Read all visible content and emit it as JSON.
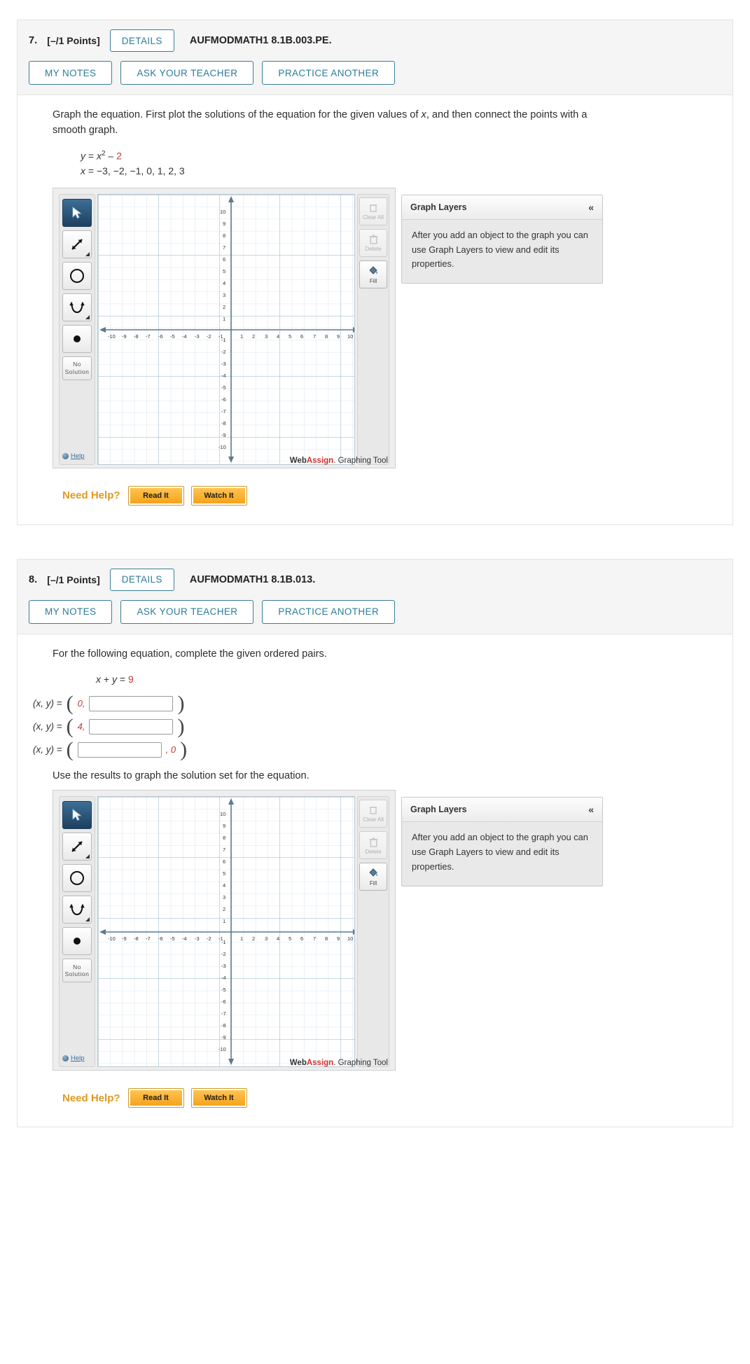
{
  "questions": [
    {
      "number": "7.",
      "points": "[–/1 Points]",
      "details_label": "DETAILS",
      "code": "AUFMODMATH1 8.1B.003.PE.",
      "buttons": [
        "MY NOTES",
        "ASK YOUR TEACHER",
        "PRACTICE ANOTHER"
      ],
      "prompt": "Graph the equation. First plot the solutions of the equation for the given values of x, and then connect the points with a smooth graph.",
      "equation_y": "y = x",
      "equation_y_exp": "2",
      "equation_y_tail": " – ",
      "equation_y_const": "2",
      "equation_x_label": "x = ",
      "equation_x_values": "−3, −2, −1, 0, 1, 2, 3",
      "graph": {
        "tools": [
          "pointer-tool",
          "segment-tool",
          "circle-tool",
          "parabola-tool",
          "point-tool"
        ],
        "no_solution_line1": "No",
        "no_solution_line2": "Solution",
        "help_label": "Help",
        "side_buttons": [
          {
            "label": "Clear All",
            "enabled": false
          },
          {
            "label": "Delete",
            "enabled": false
          },
          {
            "label": "Fill",
            "enabled": true
          }
        ],
        "footer_web": "Web",
        "footer_assign": "Assign",
        "footer_tool": ". Graphing Tool",
        "x_ticks": [
          "-10",
          "-9",
          "-8",
          "-7",
          "-6",
          "-5",
          "-4",
          "-3",
          "-2",
          "-1",
          "1",
          "2",
          "3",
          "4",
          "5",
          "6",
          "7",
          "8",
          "9",
          "10"
        ],
        "y_ticks": [
          "10",
          "9",
          "8",
          "7",
          "6",
          "5",
          "4",
          "3",
          "2",
          "1",
          "-1",
          "-2",
          "-3",
          "-4",
          "-5",
          "-6",
          "-7",
          "-8",
          "-9",
          "-10"
        ]
      },
      "layers": {
        "title": "Graph Layers",
        "collapse_icon": "«",
        "body": "After you add an object to the graph you can use Graph Layers to view and edit its properties."
      },
      "need_help": {
        "label": "Need Help?",
        "read_it": "Read It",
        "watch_it": "Watch It"
      }
    },
    {
      "number": "8.",
      "points": "[–/1 Points]",
      "details_label": "DETAILS",
      "code": "AUFMODMATH1 8.1B.013.",
      "buttons": [
        "MY NOTES",
        "ASK YOUR TEACHER",
        "PRACTICE ANOTHER"
      ],
      "prompt": "For the following equation, complete the given ordered pairs.",
      "equation": "x + y = ",
      "equation_const": "9",
      "pairs": [
        {
          "label": "(x, y)  =",
          "left_value": "0,",
          "right_value": "",
          "input_side": "right",
          "input_value": "",
          "placeholder": ""
        },
        {
          "label": "(x, y)  =",
          "left_value": "4,",
          "right_value": "",
          "input_side": "right",
          "input_value": "",
          "placeholder": ""
        },
        {
          "label": "(x, y)  =",
          "left_value": "",
          "right_value": ", 0",
          "input_side": "left",
          "input_value": "",
          "placeholder": ""
        }
      ],
      "sub_prompt": "Use the results to graph the solution set for the equation.",
      "graph": {
        "no_solution_line1": "No",
        "no_solution_line2": "Solution",
        "help_label": "Help",
        "side_buttons": [
          {
            "label": "Clear All",
            "enabled": false
          },
          {
            "label": "Delete",
            "enabled": false
          },
          {
            "label": "Fill",
            "enabled": true
          }
        ],
        "footer_web": "Web",
        "footer_assign": "Assign",
        "footer_tool": ". Graphing Tool"
      },
      "layers": {
        "title": "Graph Layers",
        "collapse_icon": "«",
        "body": "After you add an object to the graph you can use Graph Layers to view and edit its properties."
      },
      "need_help": {
        "label": "Need Help?",
        "read_it": "Read It",
        "watch_it": "Watch It"
      }
    }
  ],
  "colors": {
    "accent_blue": "#2b7b99",
    "red": "#c0392b",
    "orange": "#f4a31c",
    "grid": "#b9cedb"
  }
}
